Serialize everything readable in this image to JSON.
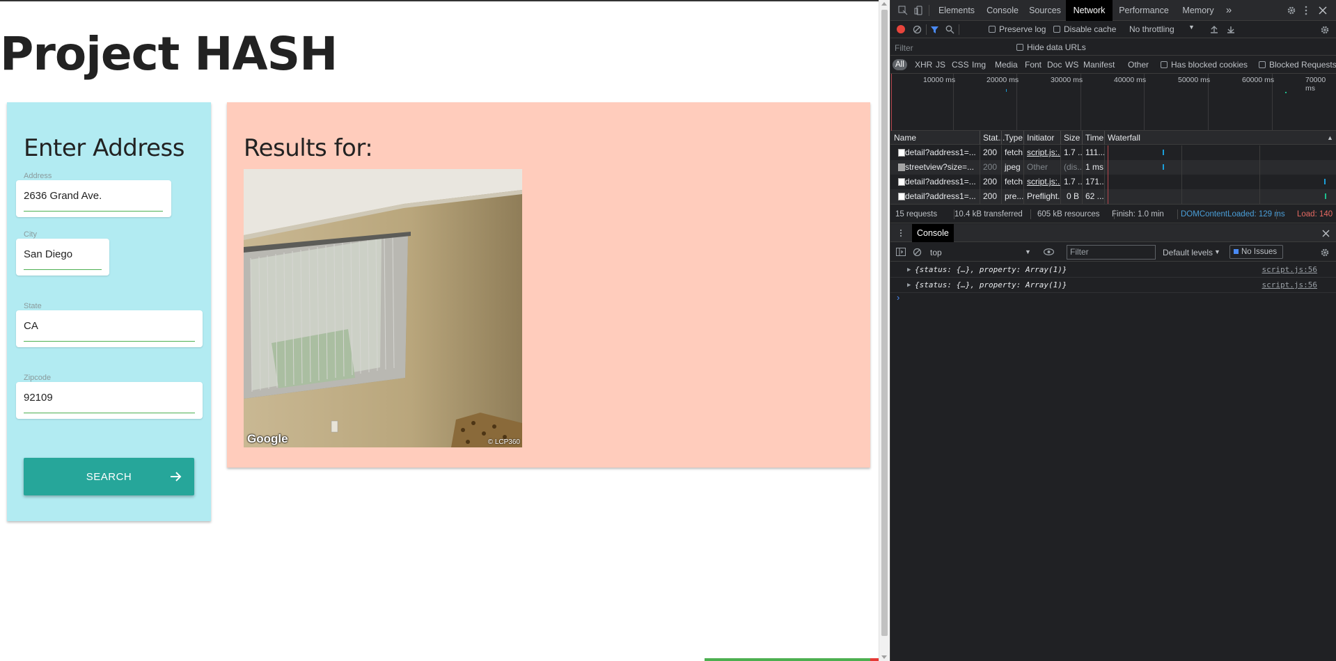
{
  "page": {
    "title": "Project HASH",
    "address_card": {
      "heading": "Enter Address",
      "fields": [
        {
          "label": "Address",
          "value": "2636 Grand Ave."
        },
        {
          "label": "City",
          "value": "San Diego"
        },
        {
          "label": "State",
          "value": "CA"
        },
        {
          "label": "Zipcode",
          "value": "92109"
        }
      ],
      "search_label": "SEARCH"
    },
    "results_card": {
      "heading": "Results for:",
      "image_credit_left": "Google",
      "image_credit_right": "© LCP360"
    }
  },
  "devtools": {
    "tabs": [
      "Elements",
      "Console",
      "Sources",
      "Network",
      "Performance",
      "Memory"
    ],
    "active_tab": "Network",
    "more_tabs": "»",
    "toolbar": {
      "preserve_log": "Preserve log",
      "disable_cache": "Disable cache",
      "throttling": "No throttling"
    },
    "filter": {
      "placeholder": "Filter",
      "hide_data_urls": "Hide data URLs"
    },
    "types": {
      "all": "All",
      "list": [
        "XHR",
        "JS",
        "CSS",
        "Img",
        "Media",
        "Font",
        "Doc",
        "WS",
        "Manifest",
        "Other"
      ],
      "has_blocked_cookies": "Has blocked cookies",
      "blocked_requests": "Blocked Requests"
    },
    "timeline_labels": [
      "10000 ms",
      "20000 ms",
      "30000 ms",
      "40000 ms",
      "50000 ms",
      "60000 ms",
      "70000 ms"
    ],
    "columns": [
      "Name",
      "Stat...",
      "Type",
      "Initiator",
      "Size",
      "Time",
      "Waterfall"
    ],
    "requests": [
      {
        "name": "detail?address1=...",
        "status": "200",
        "type": "fetch",
        "initiator": "script.js:...",
        "size": "1.7 ...",
        "time": "111..."
      },
      {
        "name": "streetview?size=...",
        "status": "200",
        "type": "jpeg",
        "initiator": "Other",
        "size": "(dis...",
        "time": "1 ms"
      },
      {
        "name": "detail?address1=...",
        "status": "200",
        "type": "fetch",
        "initiator": "script.js:...",
        "size": "1.7 ...",
        "time": "171..."
      },
      {
        "name": "detail?address1=...",
        "status": "200",
        "type": "pre...",
        "initiator": "Preflight...",
        "size": "0 B",
        "time": "62 ..."
      }
    ],
    "summary": {
      "requests": "15 requests",
      "transferred": "10.4 kB transferred",
      "resources": "605 kB resources",
      "finish": "Finish: 1.0 min",
      "dom_content_loaded": "DOMContentLoaded: 129 ms",
      "load": "Load: 140",
      "dcl_color": "#4a9fd9",
      "load_color": "#e46962"
    },
    "drawer": {
      "tab": "Console",
      "context": "top",
      "filter_placeholder": "Filter",
      "levels": "Default levels",
      "issues": "No Issues",
      "messages": [
        {
          "text": "{status: {…}, property: Array(1)}",
          "source": "script.js:56"
        },
        {
          "text": "{status: {…}, property: Array(1)}",
          "source": "script.js:56"
        }
      ],
      "prompt": "›"
    }
  }
}
